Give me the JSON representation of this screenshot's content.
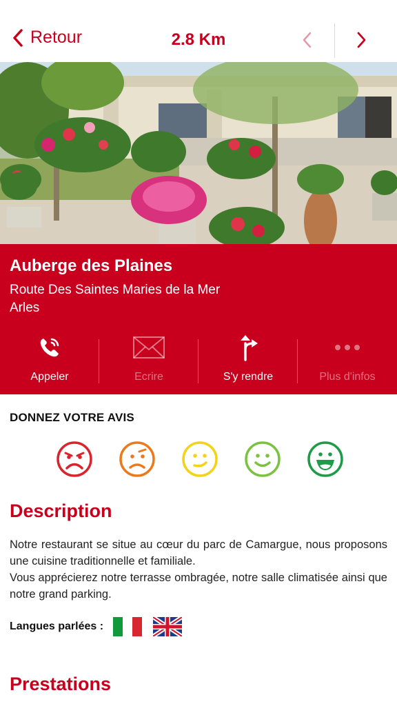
{
  "nav": {
    "back_label": "Retour",
    "distance": "2.8 Km"
  },
  "place": {
    "name": "Auberge des Plaines",
    "address_line1": "Route Des Saintes Maries de la Mer",
    "address_line2": "Arles"
  },
  "actions": [
    {
      "label": "Appeler",
      "icon": "phone-icon",
      "enabled": true
    },
    {
      "label": "Ecrire",
      "icon": "mail-icon",
      "enabled": false
    },
    {
      "label": "S'y rendre",
      "icon": "directions-icon",
      "enabled": true
    },
    {
      "label": "Plus d'infos",
      "icon": "more-icon",
      "enabled": false
    }
  ],
  "review": {
    "title": "DONNEZ VOTRE AVIS",
    "smileys": [
      {
        "icon": "very-unhappy-smiley-icon",
        "color": "#d9232d"
      },
      {
        "icon": "unhappy-smiley-icon",
        "color": "#ec7a1c"
      },
      {
        "icon": "neutral-smiley-icon",
        "color": "#f3d21a"
      },
      {
        "icon": "happy-smiley-icon",
        "color": "#7cc242"
      },
      {
        "icon": "very-happy-smiley-icon",
        "color": "#1d9b48"
      }
    ]
  },
  "description": {
    "title": "Description",
    "paragraph1": "Notre restaurant se situe au cœur du parc de Camargue, nous proposons une cuisine traditionnelle et familiale.",
    "paragraph2": "Vous apprécierez notre terrasse ombragée, notre salle climatisée ainsi que notre grand parking.",
    "languages_label": "Langues parlées :",
    "languages": [
      "italian-flag-icon",
      "uk-flag-icon"
    ]
  },
  "prestations": {
    "title": "Prestations"
  },
  "colors": {
    "accent": "#c8001e"
  }
}
